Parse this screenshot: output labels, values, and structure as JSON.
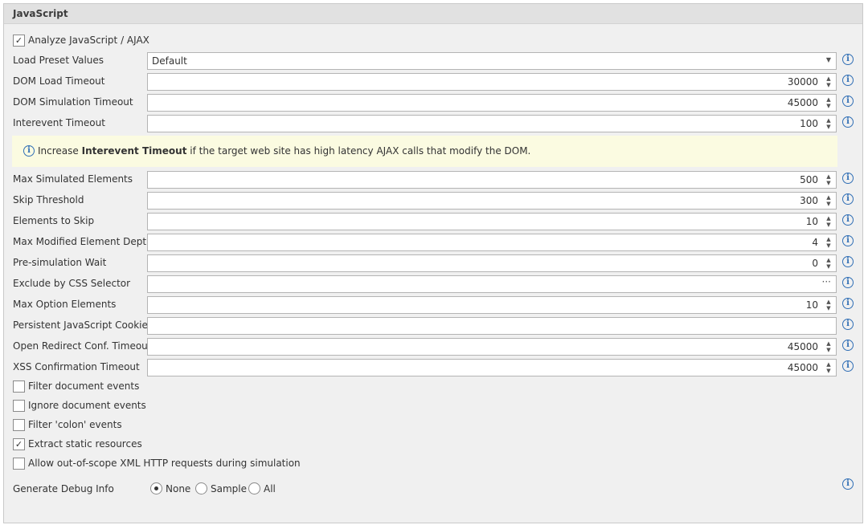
{
  "panel": {
    "title": "JavaScript"
  },
  "analyze": {
    "label": "Analyze JavaScript / AJAX",
    "checked": true
  },
  "preset": {
    "label": "Load Preset Values",
    "value": "Default"
  },
  "fields_top": [
    {
      "label": "DOM Load Timeout",
      "value": "30000"
    },
    {
      "label": "DOM Simulation Timeout",
      "value": "45000"
    },
    {
      "label": "Interevent Timeout",
      "value": "100"
    }
  ],
  "banner": {
    "prefix": "Increase ",
    "bold": "Interevent Timeout",
    "suffix": " if the target web site has high latency AJAX calls that modify the DOM."
  },
  "fields_bottom": [
    {
      "label": "Max Simulated Elements",
      "value": "500",
      "kind": "spinner"
    },
    {
      "label": "Skip Threshold",
      "value": "300",
      "kind": "spinner"
    },
    {
      "label": "Elements to Skip",
      "value": "10",
      "kind": "spinner"
    },
    {
      "label": "Max Modified Element Depth",
      "value": "4",
      "kind": "spinner"
    },
    {
      "label": "Pre-simulation Wait",
      "value": "0",
      "kind": "spinner"
    },
    {
      "label": "Exclude by CSS Selector",
      "value": "",
      "kind": "ellipsis",
      "button": "···"
    },
    {
      "label": "Max Option Elements",
      "value": "10",
      "kind": "spinner"
    },
    {
      "label": "Persistent JavaScript Cookies",
      "value": "",
      "kind": "text"
    },
    {
      "label": "Open Redirect Conf. Timeout",
      "value": "45000",
      "kind": "spinner"
    },
    {
      "label": "XSS Confirmation Timeout",
      "value": "45000",
      "kind": "spinner"
    }
  ],
  "checkboxes": [
    {
      "label": "Filter document events",
      "checked": false
    },
    {
      "label": "Ignore document events",
      "checked": false
    },
    {
      "label": "Filter 'colon' events",
      "checked": false
    },
    {
      "label": "Extract static resources",
      "checked": true
    },
    {
      "label": "Allow out-of-scope XML HTTP requests during simulation",
      "checked": false
    }
  ],
  "debug": {
    "label": "Generate Debug Info",
    "options": [
      "None",
      "Sample",
      "All"
    ],
    "selected": "None"
  },
  "glyphs": {
    "check": "✓",
    "spin_up": "▲",
    "spin_down": "▼",
    "arrow": "▼",
    "info": "i"
  },
  "colors": {
    "info_blue": "#2f6eb5",
    "banner_bg": "#fbfbe1",
    "panel_bg": "#f0f0f0"
  }
}
